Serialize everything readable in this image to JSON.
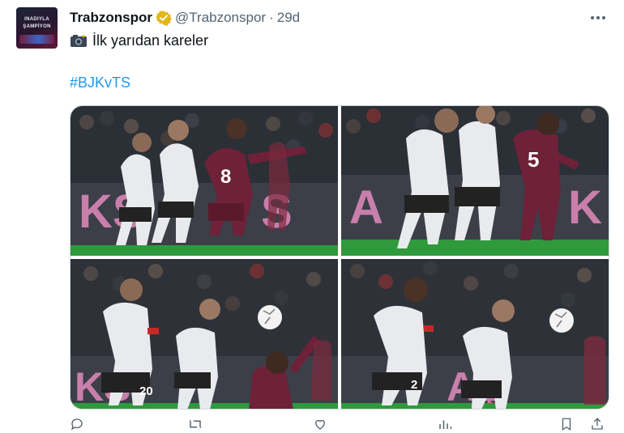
{
  "author": {
    "avatar_text": [
      "INADIYLA",
      "ŞAMPİYON"
    ],
    "name": "Trabzonspor",
    "handle": "@Trabzonspor",
    "separator": "·",
    "time": "29d"
  },
  "tweet": {
    "text": "İlk yarıdan kareler",
    "hashtag": "#BJKvTS",
    "emoji": "camera-flash-icon"
  },
  "media": {
    "photos": [
      {
        "jerseys": [
          "8"
        ]
      },
      {
        "jerseys": [
          "5"
        ]
      },
      {
        "jerseys": [
          "20"
        ]
      },
      {
        "jerseys": [
          "2"
        ]
      }
    ]
  },
  "colors": {
    "link": "#1d9bf0",
    "secondary_text": "#536471",
    "verified_gold": "#e2b719",
    "beşiktaş_kit": "#e9eaee",
    "trabzonspor_kit": "#6e2138",
    "pitch": "#2f9a3b"
  }
}
